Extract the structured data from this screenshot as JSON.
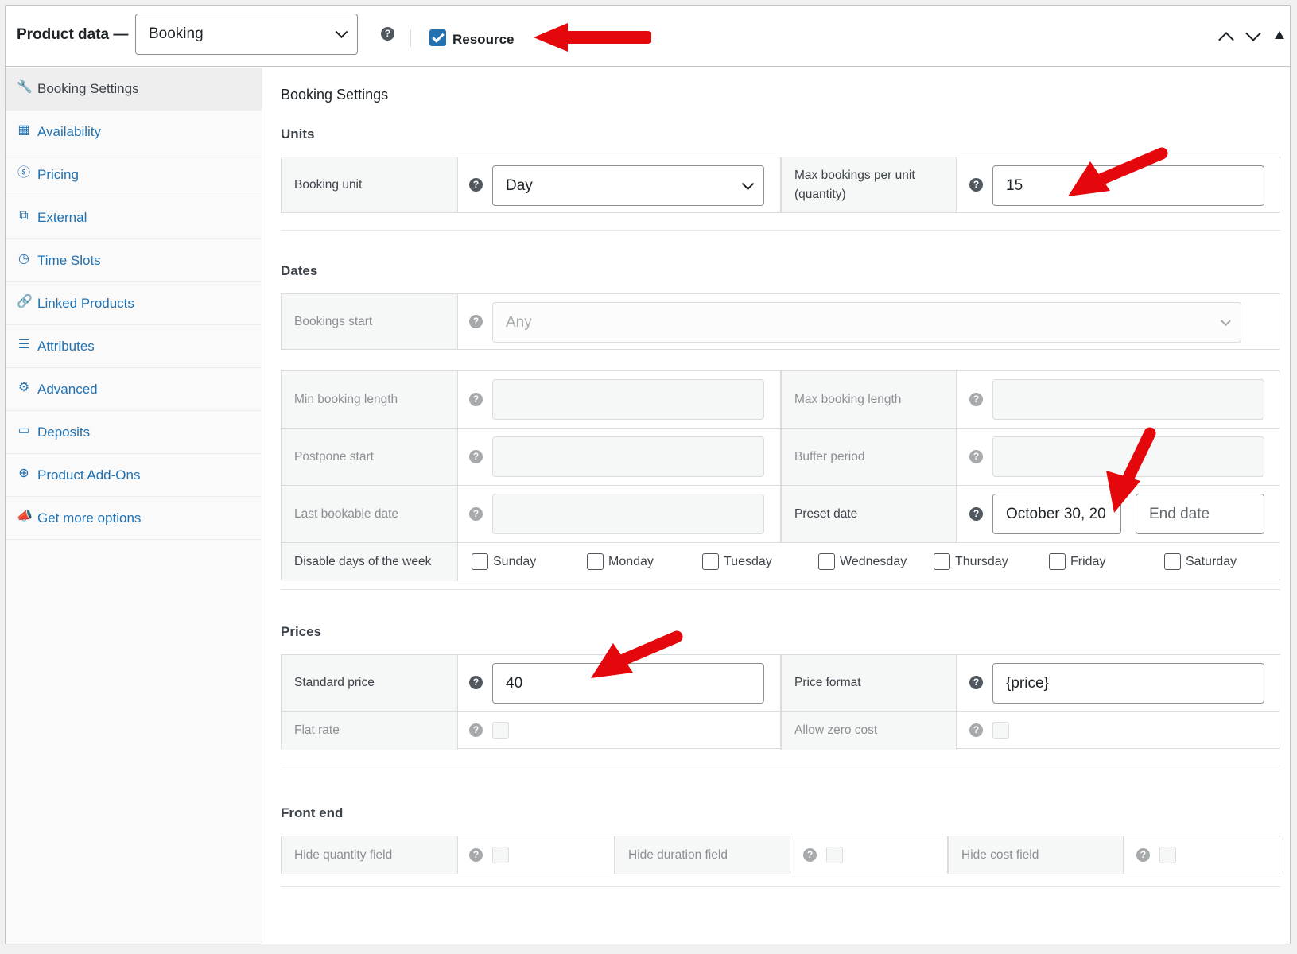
{
  "header": {
    "title": "Product data —",
    "product_type": "Booking",
    "resource_label": "Resource",
    "resource_checked": true
  },
  "sidebar": {
    "items": [
      {
        "label": "Booking Settings",
        "icon": "wrench-icon",
        "active": true
      },
      {
        "label": "Availability",
        "icon": "calendar-icon"
      },
      {
        "label": "Pricing",
        "icon": "dollar-icon"
      },
      {
        "label": "External",
        "icon": "external-link-icon"
      },
      {
        "label": "Time Slots",
        "icon": "clock-icon"
      },
      {
        "label": "Linked Products",
        "icon": "link-icon"
      },
      {
        "label": "Attributes",
        "icon": "list-icon"
      },
      {
        "label": "Advanced",
        "icon": "gear-icon"
      },
      {
        "label": "Deposits",
        "icon": "card-icon"
      },
      {
        "label": "Product Add-Ons",
        "icon": "plus-circle-icon"
      },
      {
        "label": "Get more options",
        "icon": "megaphone-icon"
      }
    ]
  },
  "main": {
    "title": "Booking Settings",
    "units": {
      "heading": "Units",
      "booking_unit_label": "Booking unit",
      "booking_unit_value": "Day",
      "max_bookings_label_1": "Max bookings per unit",
      "max_bookings_label_2": "(quantity)",
      "max_bookings_value": "15"
    },
    "dates": {
      "heading": "Dates",
      "bookings_start_label": "Bookings start",
      "bookings_start_value": "Any",
      "min_length_label": "Min booking length",
      "max_length_label": "Max booking length",
      "postpone_label": "Postpone start",
      "buffer_label": "Buffer period",
      "last_bookable_label": "Last bookable date",
      "preset_label": "Preset date",
      "preset_start": "October 30, 20",
      "preset_end_placeholder": "End date",
      "disable_days_label": "Disable days of the week",
      "days": [
        "Sunday",
        "Monday",
        "Tuesday",
        "Wednesday",
        "Thursday",
        "Friday",
        "Saturday"
      ]
    },
    "prices": {
      "heading": "Prices",
      "standard_label": "Standard price",
      "standard_value": "40",
      "format_label": "Price format",
      "format_value": "{price}",
      "flat_rate_label": "Flat rate",
      "zero_cost_label": "Allow zero cost"
    },
    "front_end": {
      "heading": "Front end",
      "hide_quantity_label": "Hide quantity field",
      "hide_duration_label": "Hide duration field",
      "hide_cost_label": "Hide cost field"
    }
  },
  "colors": {
    "link": "#2271b1",
    "annotation_arrow": "#e4070b"
  }
}
